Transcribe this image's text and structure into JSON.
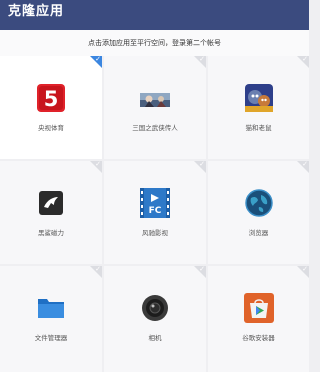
{
  "header": {
    "title": "克隆应用"
  },
  "hint": "点击添加应用至平行空间，登录第二个帐号",
  "apps": [
    {
      "label": "央视体育",
      "icon": "cctv5-icon",
      "selected": true
    },
    {
      "label": "三国之武侠传人",
      "icon": "game-banner-icon",
      "selected": false
    },
    {
      "label": "猫和老鼠",
      "icon": "tom-jerry-icon",
      "selected": false
    },
    {
      "label": "黑鲨磁力",
      "icon": "shark-icon",
      "selected": false
    },
    {
      "label": "风驰影视",
      "icon": "film-icon",
      "selected": false
    },
    {
      "label": "浏览器",
      "icon": "globe-icon",
      "selected": false
    },
    {
      "label": "文件管理器",
      "icon": "folder-icon",
      "selected": false
    },
    {
      "label": "相机",
      "icon": "camera-icon",
      "selected": false
    },
    {
      "label": "谷歌安装器",
      "icon": "google-installer-icon",
      "selected": false
    }
  ],
  "colors": {
    "header": "#3b4b7f",
    "accent": "#3b86e0"
  }
}
